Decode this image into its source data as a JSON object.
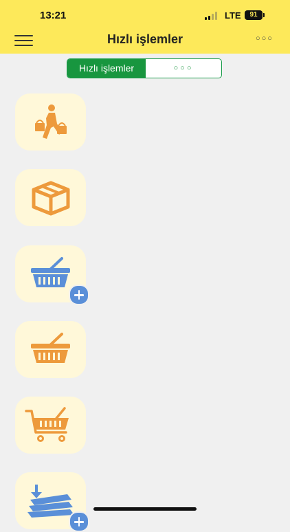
{
  "status_bar": {
    "time": "13:21",
    "network": "LTE",
    "battery": "91"
  },
  "app_bar": {
    "title": "Hızlı işlemler",
    "more_label": "○○○"
  },
  "segmented": {
    "active_label": "Hızlı işlemler",
    "other_label": "○○○"
  },
  "tiles": [
    {
      "icon": "shopping-person-icon",
      "color": "#ed9a3c"
    },
    {
      "icon": "package-box-icon",
      "color": "#ed9a3c"
    },
    {
      "icon": "basket-add-icon",
      "color": "#5a8fd8"
    },
    {
      "icon": "basket-icon",
      "color": "#ed9a3c"
    },
    {
      "icon": "shopping-cart-icon",
      "color": "#ed9a3c"
    },
    {
      "icon": "stacked-documents-download-icon",
      "color": "#5a8fd8"
    }
  ],
  "colors": {
    "header": "#fde95a",
    "accent_green": "#18963f",
    "tile_bg": "#fff8d9",
    "orange": "#ed9a3c",
    "blue": "#5a8fd8"
  }
}
